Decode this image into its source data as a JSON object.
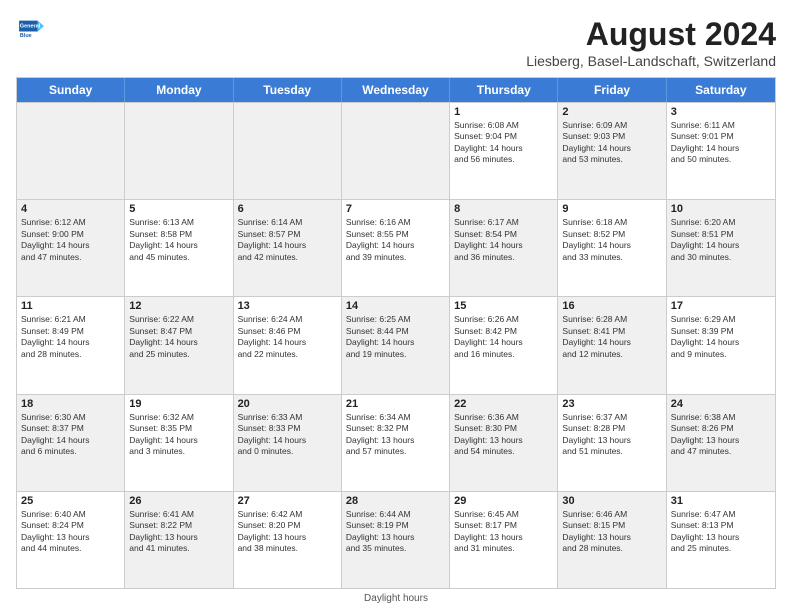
{
  "header": {
    "title": "August 2024",
    "subtitle": "Liesberg, Basel-Landschaft, Switzerland",
    "logo_general": "General",
    "logo_blue": "Blue"
  },
  "days_of_week": [
    "Sunday",
    "Monday",
    "Tuesday",
    "Wednesday",
    "Thursday",
    "Friday",
    "Saturday"
  ],
  "footer": {
    "daylight_label": "Daylight hours"
  },
  "weeks": [
    [
      {
        "day": "",
        "info": "",
        "shaded": true
      },
      {
        "day": "",
        "info": "",
        "shaded": true
      },
      {
        "day": "",
        "info": "",
        "shaded": true
      },
      {
        "day": "",
        "info": "",
        "shaded": true
      },
      {
        "day": "1",
        "info": "Sunrise: 6:08 AM\nSunset: 9:04 PM\nDaylight: 14 hours\nand 56 minutes."
      },
      {
        "day": "2",
        "info": "Sunrise: 6:09 AM\nSunset: 9:03 PM\nDaylight: 14 hours\nand 53 minutes.",
        "shaded": true
      },
      {
        "day": "3",
        "info": "Sunrise: 6:11 AM\nSunset: 9:01 PM\nDaylight: 14 hours\nand 50 minutes."
      }
    ],
    [
      {
        "day": "4",
        "info": "Sunrise: 6:12 AM\nSunset: 9:00 PM\nDaylight: 14 hours\nand 47 minutes.",
        "shaded": true
      },
      {
        "day": "5",
        "info": "Sunrise: 6:13 AM\nSunset: 8:58 PM\nDaylight: 14 hours\nand 45 minutes."
      },
      {
        "day": "6",
        "info": "Sunrise: 6:14 AM\nSunset: 8:57 PM\nDaylight: 14 hours\nand 42 minutes.",
        "shaded": true
      },
      {
        "day": "7",
        "info": "Sunrise: 6:16 AM\nSunset: 8:55 PM\nDaylight: 14 hours\nand 39 minutes."
      },
      {
        "day": "8",
        "info": "Sunrise: 6:17 AM\nSunset: 8:54 PM\nDaylight: 14 hours\nand 36 minutes.",
        "shaded": true
      },
      {
        "day": "9",
        "info": "Sunrise: 6:18 AM\nSunset: 8:52 PM\nDaylight: 14 hours\nand 33 minutes."
      },
      {
        "day": "10",
        "info": "Sunrise: 6:20 AM\nSunset: 8:51 PM\nDaylight: 14 hours\nand 30 minutes.",
        "shaded": true
      }
    ],
    [
      {
        "day": "11",
        "info": "Sunrise: 6:21 AM\nSunset: 8:49 PM\nDaylight: 14 hours\nand 28 minutes."
      },
      {
        "day": "12",
        "info": "Sunrise: 6:22 AM\nSunset: 8:47 PM\nDaylight: 14 hours\nand 25 minutes.",
        "shaded": true
      },
      {
        "day": "13",
        "info": "Sunrise: 6:24 AM\nSunset: 8:46 PM\nDaylight: 14 hours\nand 22 minutes."
      },
      {
        "day": "14",
        "info": "Sunrise: 6:25 AM\nSunset: 8:44 PM\nDaylight: 14 hours\nand 19 minutes.",
        "shaded": true
      },
      {
        "day": "15",
        "info": "Sunrise: 6:26 AM\nSunset: 8:42 PM\nDaylight: 14 hours\nand 16 minutes."
      },
      {
        "day": "16",
        "info": "Sunrise: 6:28 AM\nSunset: 8:41 PM\nDaylight: 14 hours\nand 12 minutes.",
        "shaded": true
      },
      {
        "day": "17",
        "info": "Sunrise: 6:29 AM\nSunset: 8:39 PM\nDaylight: 14 hours\nand 9 minutes."
      }
    ],
    [
      {
        "day": "18",
        "info": "Sunrise: 6:30 AM\nSunset: 8:37 PM\nDaylight: 14 hours\nand 6 minutes.",
        "shaded": true
      },
      {
        "day": "19",
        "info": "Sunrise: 6:32 AM\nSunset: 8:35 PM\nDaylight: 14 hours\nand 3 minutes."
      },
      {
        "day": "20",
        "info": "Sunrise: 6:33 AM\nSunset: 8:33 PM\nDaylight: 14 hours\nand 0 minutes.",
        "shaded": true
      },
      {
        "day": "21",
        "info": "Sunrise: 6:34 AM\nSunset: 8:32 PM\nDaylight: 13 hours\nand 57 minutes."
      },
      {
        "day": "22",
        "info": "Sunrise: 6:36 AM\nSunset: 8:30 PM\nDaylight: 13 hours\nand 54 minutes.",
        "shaded": true
      },
      {
        "day": "23",
        "info": "Sunrise: 6:37 AM\nSunset: 8:28 PM\nDaylight: 13 hours\nand 51 minutes."
      },
      {
        "day": "24",
        "info": "Sunrise: 6:38 AM\nSunset: 8:26 PM\nDaylight: 13 hours\nand 47 minutes.",
        "shaded": true
      }
    ],
    [
      {
        "day": "25",
        "info": "Sunrise: 6:40 AM\nSunset: 8:24 PM\nDaylight: 13 hours\nand 44 minutes."
      },
      {
        "day": "26",
        "info": "Sunrise: 6:41 AM\nSunset: 8:22 PM\nDaylight: 13 hours\nand 41 minutes.",
        "shaded": true
      },
      {
        "day": "27",
        "info": "Sunrise: 6:42 AM\nSunset: 8:20 PM\nDaylight: 13 hours\nand 38 minutes."
      },
      {
        "day": "28",
        "info": "Sunrise: 6:44 AM\nSunset: 8:19 PM\nDaylight: 13 hours\nand 35 minutes.",
        "shaded": true
      },
      {
        "day": "29",
        "info": "Sunrise: 6:45 AM\nSunset: 8:17 PM\nDaylight: 13 hours\nand 31 minutes."
      },
      {
        "day": "30",
        "info": "Sunrise: 6:46 AM\nSunset: 8:15 PM\nDaylight: 13 hours\nand 28 minutes.",
        "shaded": true
      },
      {
        "day": "31",
        "info": "Sunrise: 6:47 AM\nSunset: 8:13 PM\nDaylight: 13 hours\nand 25 minutes."
      }
    ]
  ]
}
